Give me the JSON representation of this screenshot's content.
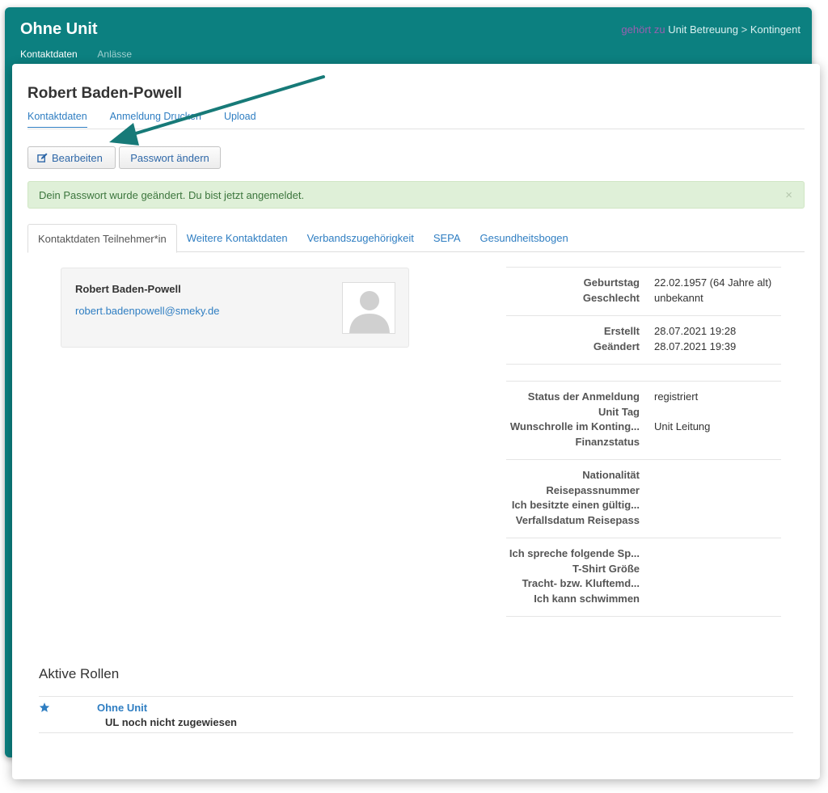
{
  "app": {
    "title": "Ohne Unit",
    "breadcrumb": {
      "prefix": "gehört zu",
      "unit": "Unit Betreuung",
      "separator": ">",
      "parent": "Kontingent"
    },
    "nav": [
      {
        "label": "Kontaktdaten"
      },
      {
        "label": "Anlässe"
      }
    ]
  },
  "person": {
    "name": "Robert Baden-Powell",
    "email": "robert.badenpowell@smeky.de",
    "subtabs": [
      {
        "label": "Kontaktdaten"
      },
      {
        "label": "Anmeldung Drucken"
      },
      {
        "label": "Upload"
      }
    ]
  },
  "actions": {
    "edit_label": "Bearbeiten",
    "password_label": "Passwort ändern"
  },
  "alert": {
    "message": "Dein Passwort wurde geändert. Du bist jetzt angemeldet.",
    "close": "×"
  },
  "tabs": [
    {
      "label": "Kontaktdaten Teilnehmer*in"
    },
    {
      "label": "Weitere Kontaktdaten"
    },
    {
      "label": "Verbandszugehörigkeit"
    },
    {
      "label": "SEPA"
    },
    {
      "label": "Gesundheitsbogen"
    }
  ],
  "details": {
    "s1": [
      {
        "k": "Geburtstag",
        "v": "22.02.1957 (64 Jahre alt)"
      },
      {
        "k": "Geschlecht",
        "v": "unbekannt"
      }
    ],
    "s2": [
      {
        "k": "Erstellt",
        "v": "28.07.2021 19:28"
      },
      {
        "k": "Geändert",
        "v": "28.07.2021 19:39"
      }
    ],
    "s3": [
      {
        "k": "Status der Anmeldung",
        "v": "registriert"
      },
      {
        "k": "Unit Tag",
        "v": ""
      },
      {
        "k": "Wunschrolle im Konting...",
        "v": "Unit Leitung"
      },
      {
        "k": "Finanzstatus",
        "v": ""
      }
    ],
    "s4": [
      {
        "k": "Nationalität",
        "v": ""
      },
      {
        "k": "Reisepassnummer",
        "v": ""
      },
      {
        "k": "Ich besitzte einen gültig...",
        "v": ""
      },
      {
        "k": "Verfallsdatum Reisepass",
        "v": ""
      }
    ],
    "s5": [
      {
        "k": "Ich spreche folgende Sp...",
        "v": ""
      },
      {
        "k": "T-Shirt Größe",
        "v": ""
      },
      {
        "k": "Tracht- bzw. Kluftemd...",
        "v": ""
      },
      {
        "k": "Ich kann schwimmen",
        "v": ""
      }
    ]
  },
  "roles": {
    "title": "Aktive Rollen",
    "items": [
      {
        "group": "Ohne Unit",
        "role": "UL noch nicht zugewiesen"
      }
    ]
  },
  "icons": {
    "edit": "edit-icon",
    "star": "star-icon",
    "avatar": "avatar-placeholder-icon",
    "arrow": "annotation-arrow"
  },
  "colors": {
    "header": "#0c8080",
    "link": "#2f7ec2",
    "alert_bg": "#dff0d8",
    "alert_text": "#3c763d"
  }
}
